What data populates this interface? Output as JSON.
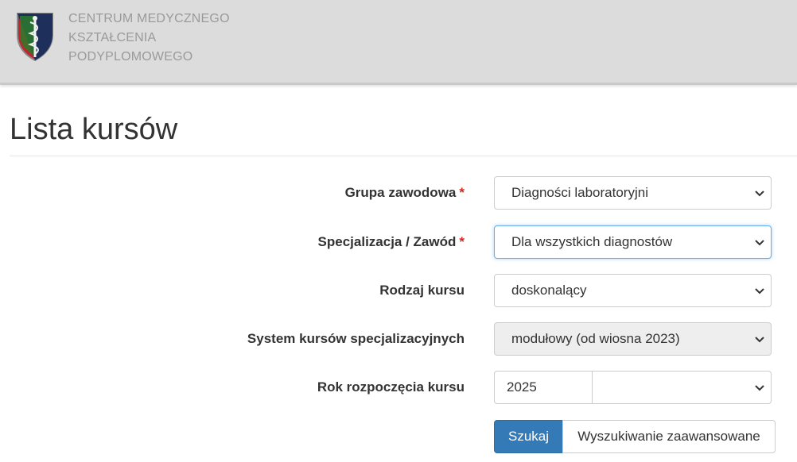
{
  "header": {
    "org_name_lines": [
      "CENTRUM MEDYCZNEGO",
      "KSZTAŁCENIA",
      "PODYPLOMOWEGO"
    ],
    "logo_icon": "caduceus-shield-logo"
  },
  "page": {
    "title": "Lista kursów"
  },
  "form": {
    "required_mark": "*",
    "grupa_zawodowa": {
      "label": "Grupa zawodowa",
      "value": "Diagności laboratoryjni"
    },
    "specjalizacja": {
      "label": "Specjalizacja / Zawód",
      "value": "Dla wszystkich diagnostów"
    },
    "rodzaj_kursu": {
      "label": "Rodzaj kursu",
      "value": "doskonalący"
    },
    "system_kursow": {
      "label": "System kursów specjalizacyjnych",
      "value": "modułowy (od wiosna 2023)"
    },
    "rok_rozpoczecia": {
      "label": "Rok rozpoczęcia kursu",
      "year_value": "2025",
      "select_value": ""
    }
  },
  "buttons": {
    "search_label": "Szukaj",
    "advanced_label": "Wyszukiwanie zaawansowane"
  },
  "colors": {
    "header_bg": "#dcdcdc",
    "primary": "#337ab7",
    "required": "#d9261c",
    "logo_navy": "#1f2f5c",
    "logo_red": "#c0262d"
  }
}
